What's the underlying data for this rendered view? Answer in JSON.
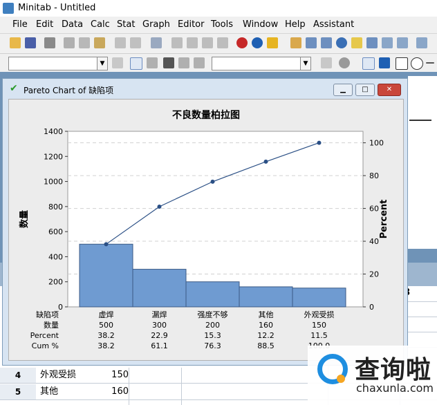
{
  "app": {
    "title": "Minitab - Untitled"
  },
  "menu": [
    "File",
    "Edit",
    "Data",
    "Calc",
    "Stat",
    "Graph",
    "Editor",
    "Tools",
    "Window",
    "Help",
    "Assistant"
  ],
  "chart_window": {
    "title": "Pareto Chart of 缺陷项"
  },
  "chart_data": {
    "type": "bar",
    "title": "不良数量柏拉图",
    "ylabel": "数量",
    "y2label": "Percent",
    "categories": [
      "虚焊",
      "漏焊",
      "强度不够",
      "其他",
      "外观受损"
    ],
    "values": [
      500,
      300,
      200,
      160,
      150
    ],
    "cum_percent": [
      38.2,
      61.1,
      76.3,
      88.5,
      100.0
    ],
    "ylim": [
      0,
      1400
    ],
    "yticks": [
      0,
      200,
      400,
      600,
      800,
      1000,
      1200,
      1400
    ],
    "y2lim": [
      0,
      107
    ],
    "y2ticks": [
      0,
      20,
      40,
      60,
      80,
      100
    ],
    "bar_color": "#6f9bd1",
    "line_color": "#2a4f85",
    "table": {
      "row_labels": [
        "缺陷项",
        "数量",
        "Percent",
        "Cum %"
      ],
      "rows": [
        [
          "虚焊",
          "漏焊",
          "强度不够",
          "其他",
          "外观受损"
        ],
        [
          "500",
          "300",
          "200",
          "160",
          "150"
        ],
        [
          "38.2",
          "22.9",
          "15.3",
          "12.2",
          "11.5"
        ],
        [
          "38.2",
          "61.1",
          "76.3",
          "88.5",
          "100.0"
        ]
      ]
    }
  },
  "worksheet": {
    "column_8": "8",
    "rows": [
      {
        "num": "4",
        "name": "外观受损",
        "value": "150"
      },
      {
        "num": "5",
        "name": "其他",
        "value": "160"
      }
    ]
  },
  "watermark": {
    "cn": "查询啦",
    "en": "chaxunla.com"
  }
}
